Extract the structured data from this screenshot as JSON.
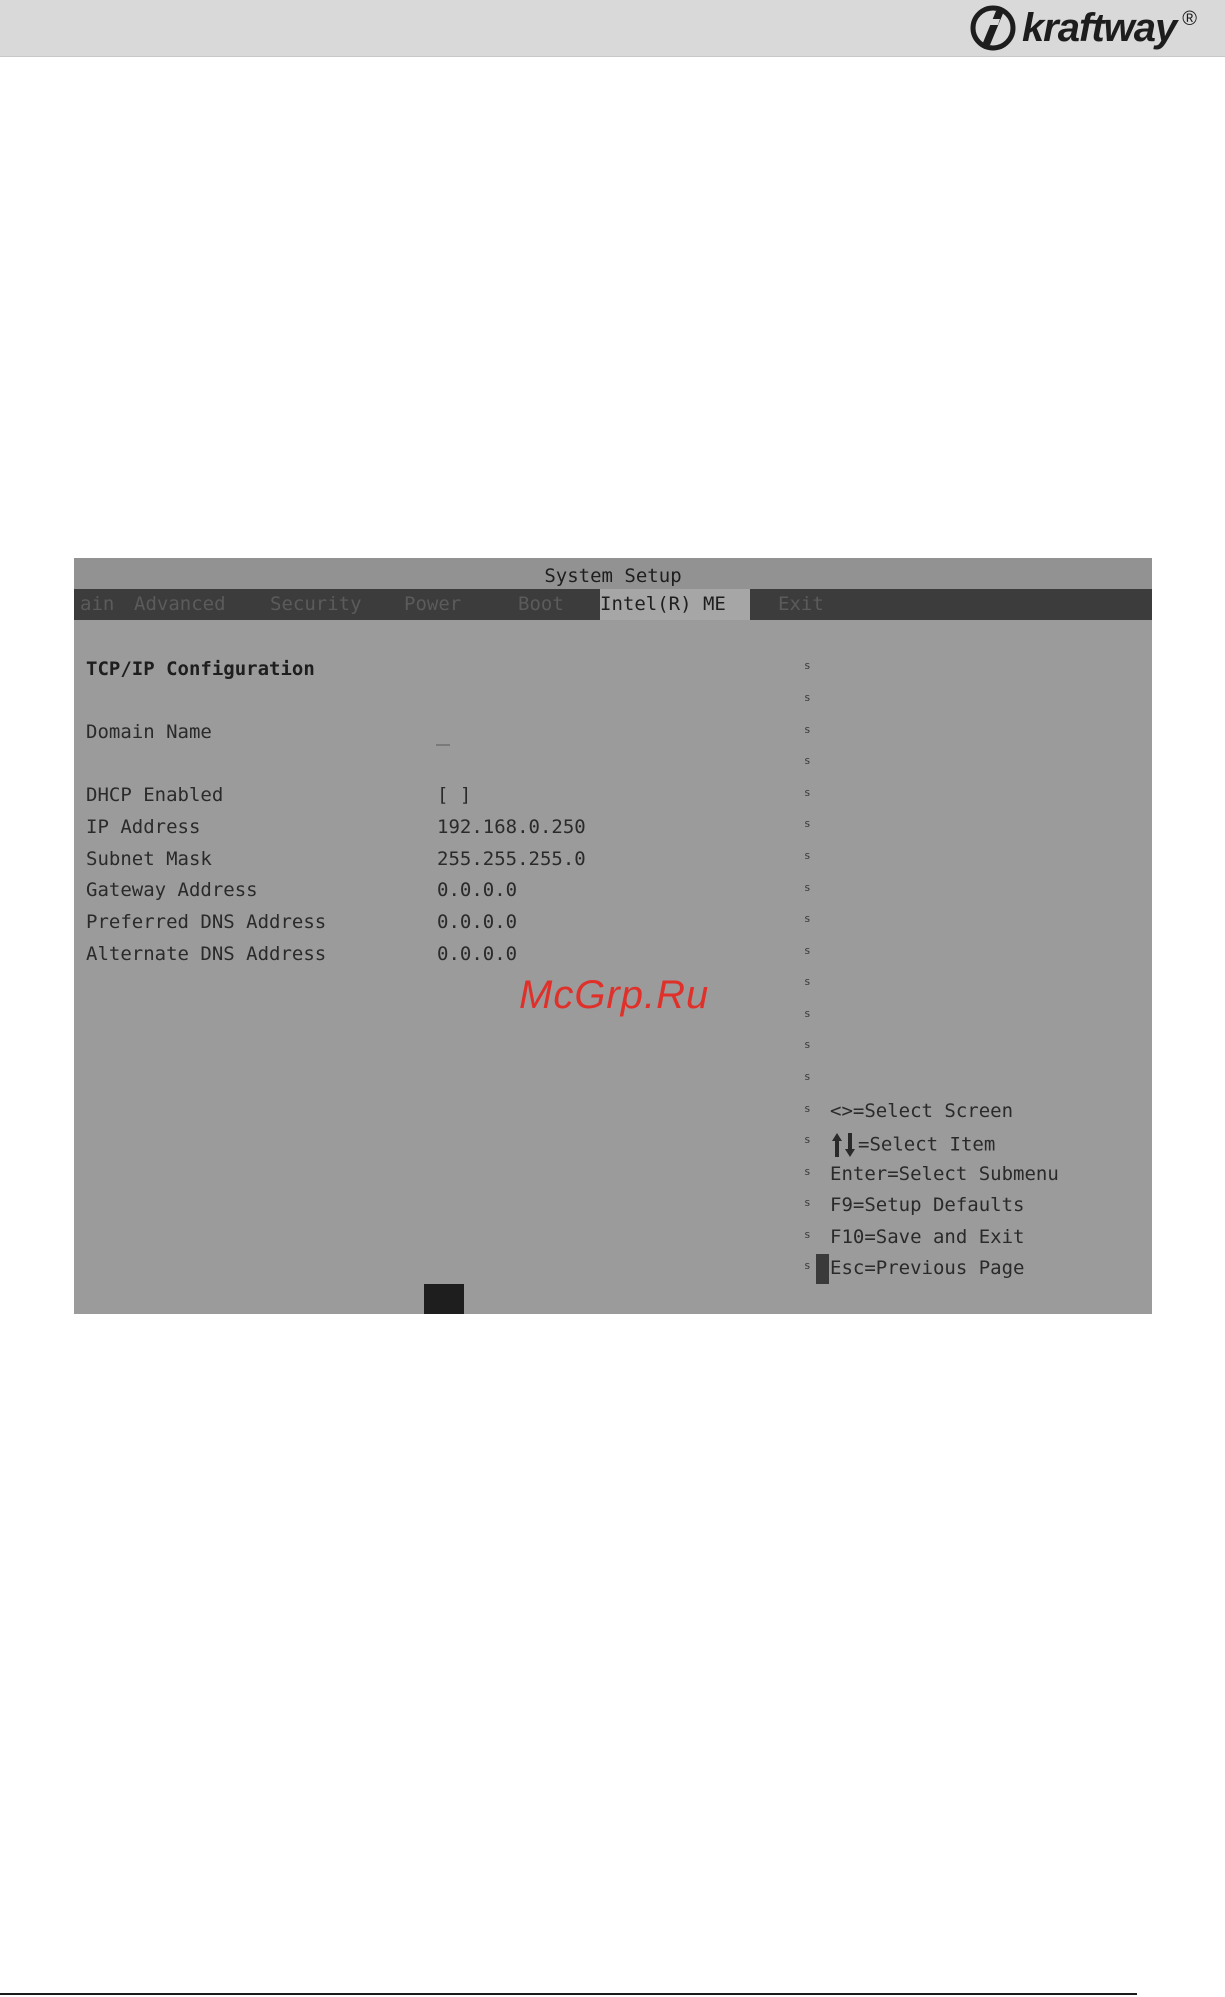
{
  "header": {
    "brand": "kraftway",
    "reg_mark": "®"
  },
  "bios": {
    "title": "System Setup",
    "tabs": [
      {
        "label": "ain"
      },
      {
        "label": "Advanced"
      },
      {
        "label": "Security"
      },
      {
        "label": "Power"
      },
      {
        "label": "Boot"
      },
      {
        "label": "Intel(R) ME",
        "active": true
      },
      {
        "label": "Exit"
      }
    ],
    "section_title": "TCP/IP Configuration",
    "fields": [
      {
        "label": "Domain Name",
        "value": ""
      },
      {
        "label": "DHCP Enabled",
        "value": "[ ]"
      },
      {
        "label": "IP Address",
        "value": "192.168.0.250"
      },
      {
        "label": "Subnet Mask",
        "value": "255.255.255.0"
      },
      {
        "label": "Gateway Address",
        "value": "0.0.0.0"
      },
      {
        "label": "Preferred DNS Address",
        "value": "0.0.0.0"
      },
      {
        "label": "Alternate DNS Address",
        "value": "0.0.0.0"
      }
    ],
    "divider_glyph": "s",
    "help": [
      "<>=Select Screen",
      "=Select Item",
      "Enter=Select Submenu",
      "F9=Setup Defaults",
      "F10=Save and Exit",
      "Esc=Previous Page"
    ]
  },
  "watermark": "McGrp.Ru",
  "colors": {
    "bios_bg": "#9b9b9b",
    "tab_bar": "#3c3c3c",
    "active_tab": "#a6a6a6",
    "watermark": "#e0302a"
  }
}
